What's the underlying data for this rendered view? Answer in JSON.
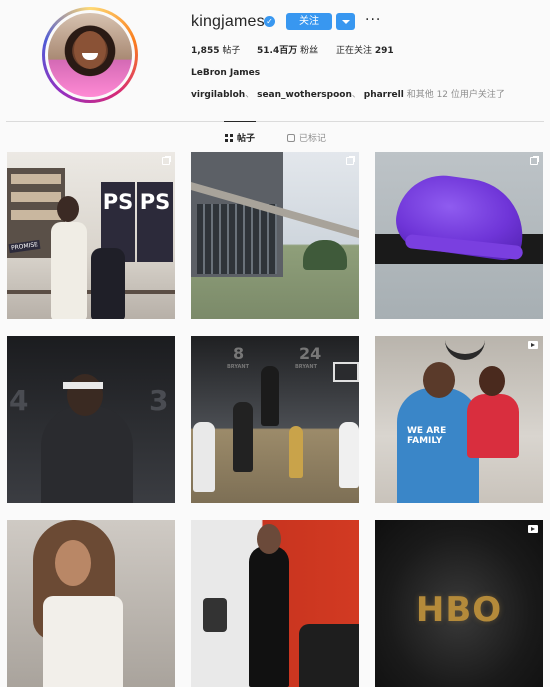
{
  "profile": {
    "username": "kingjames",
    "verified_glyph": "✓",
    "follow_label": "关注",
    "more_glyph": "···",
    "full_name": "LeBron James",
    "stats": [
      {
        "count": "1,855",
        "label": " 帖子"
      },
      {
        "count": "51.4百万",
        "label": " 粉丝"
      },
      {
        "label_prefix": "正在关注 ",
        "count": "291"
      }
    ],
    "followed_by": {
      "names": [
        "virgilabloh",
        "sean_wotherspoon",
        "pharrell"
      ],
      "separator": "、",
      "rest": "和其他 12 位用户关注了"
    }
  },
  "tabs": [
    {
      "label": "帖子",
      "icon": "grid-icon",
      "active": true
    },
    {
      "label": "已标记",
      "icon": "tag-icon",
      "active": false
    }
  ],
  "posts": [
    {
      "id": "post-1",
      "badge": "multi",
      "text": [
        "PS",
        "PS",
        "PROMISE"
      ]
    },
    {
      "id": "post-2",
      "badge": "multi"
    },
    {
      "id": "post-3",
      "badge": "multi"
    },
    {
      "id": "post-4",
      "badge": "none",
      "text": [
        "4",
        "3"
      ]
    },
    {
      "id": "post-5",
      "badge": "none",
      "text": [
        "8",
        "24",
        "BRYANT",
        "BRYANT"
      ]
    },
    {
      "id": "post-6",
      "badge": "video",
      "text": [
        "WE ARE",
        "FAMILY"
      ]
    },
    {
      "id": "post-7",
      "badge": "none"
    },
    {
      "id": "post-8",
      "badge": "none"
    },
    {
      "id": "post-9",
      "badge": "video",
      "text": [
        "HBO"
      ]
    }
  ],
  "colors": {
    "accent": "#3897f0",
    "text_primary": "#262626",
    "text_secondary": "#8e8e8e",
    "background": "#fafafa",
    "divider": "#dbdbdb"
  }
}
